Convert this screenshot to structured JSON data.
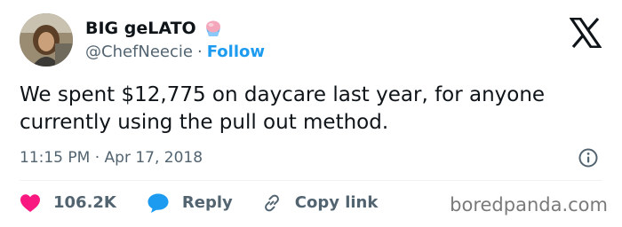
{
  "author": {
    "display_name": "BIG geLATO",
    "handle": "@ChefNeecie",
    "separator": "·",
    "follow_label": "Follow",
    "name_emoji": "shaved-ice-icon"
  },
  "tweet": {
    "text": "We spent $12,775 on daycare last year, for anyone currently using the pull out method.",
    "timestamp": "11:15 PM · Apr 17, 2018"
  },
  "actions": {
    "like_count": "106.2K",
    "reply_label": "Reply",
    "copy_label": "Copy link"
  },
  "watermark": "boredpanda.com",
  "icons": {
    "brand": "x-logo-icon",
    "info": "info-icon",
    "like": "heart-icon",
    "reply": "speech-bubble-icon",
    "copy": "link-icon"
  },
  "colors": {
    "text": "#0f1419",
    "secondary": "#536471",
    "accent": "#1d9bf0",
    "like": "#f91880",
    "watermark": "#7a7a7a"
  }
}
